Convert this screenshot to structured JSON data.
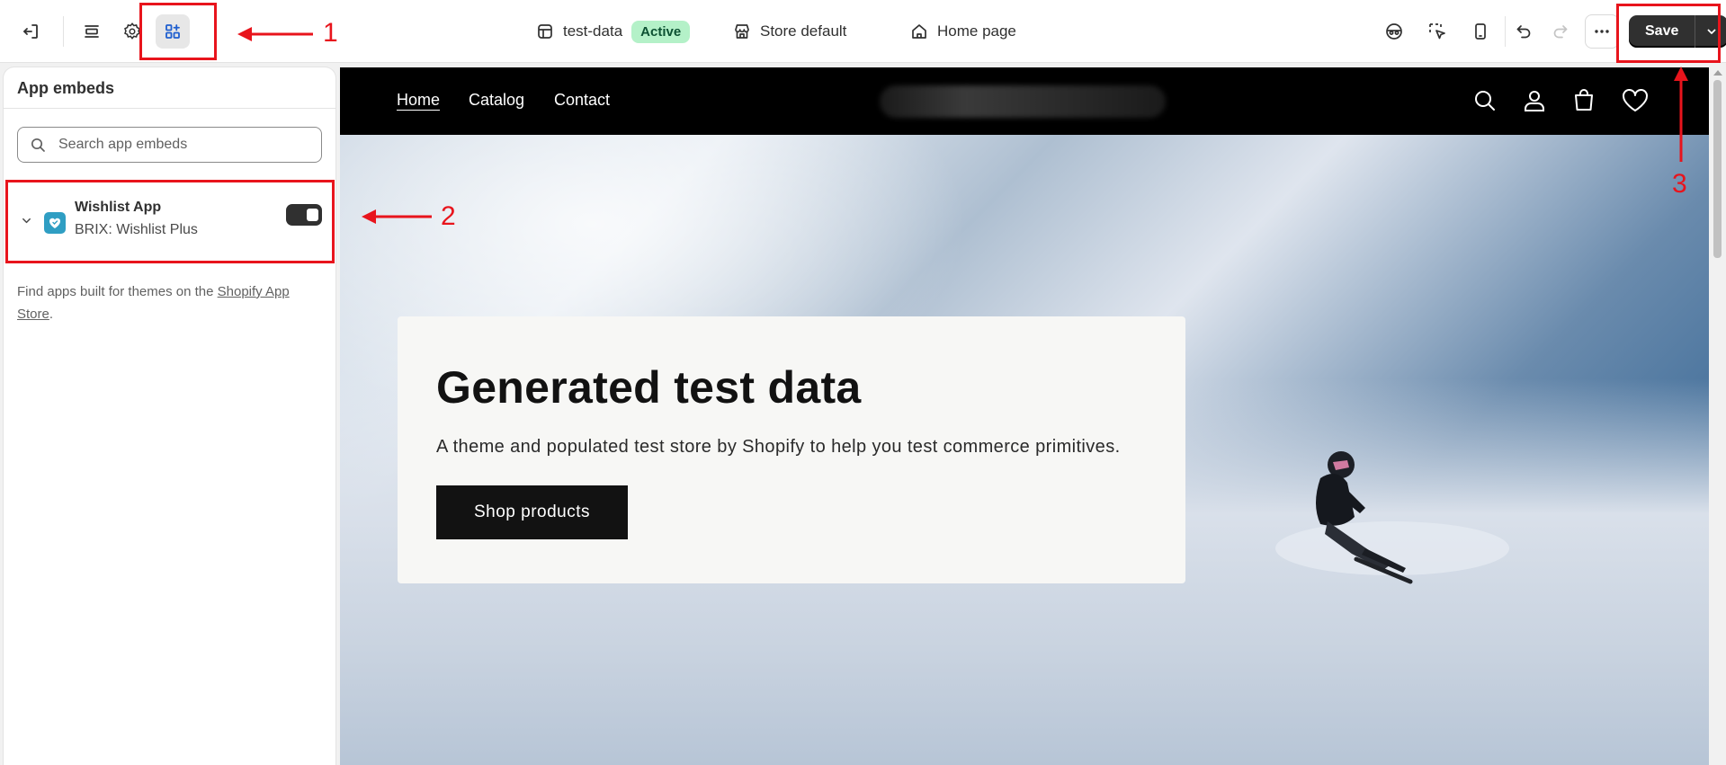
{
  "topbar": {
    "theme_name": "test-data",
    "theme_status": "Active",
    "store_context": "Store default",
    "page_selector": "Home page",
    "save_label": "Save",
    "icons": [
      "exit-icon",
      "sections-icon",
      "settings-icon",
      "app-embeds-icon",
      "preview-inspector-icon",
      "select-element-icon",
      "mobile-preview-icon",
      "undo-icon",
      "redo-icon",
      "more-icon",
      "chevron-down-icon"
    ]
  },
  "sidebar": {
    "title": "App embeds",
    "search_placeholder": "Search app embeds",
    "embed": {
      "name": "Wishlist App",
      "provider": "BRIX: Wishlist Plus",
      "enabled": true
    },
    "help_prefix": "Find apps built for themes on the ",
    "help_link": "Shopify App Store",
    "help_suffix": "."
  },
  "preview": {
    "nav_links": [
      "Home",
      "Catalog",
      "Contact"
    ],
    "nav_icons": [
      "search-icon",
      "account-icon",
      "cart-icon",
      "wishlist-heart-icon"
    ],
    "hero_title": "Generated test data",
    "hero_text": "A theme and populated test store by Shopify to help you test commerce primitives.",
    "hero_button": "Shop products"
  },
  "annotations": [
    "1",
    "2",
    "3"
  ],
  "colors": {
    "accent_dark": "#303030",
    "active_badge_bg": "#b4f1c8",
    "annotation_red": "#e8141c",
    "store_header_bg": "#000000"
  }
}
